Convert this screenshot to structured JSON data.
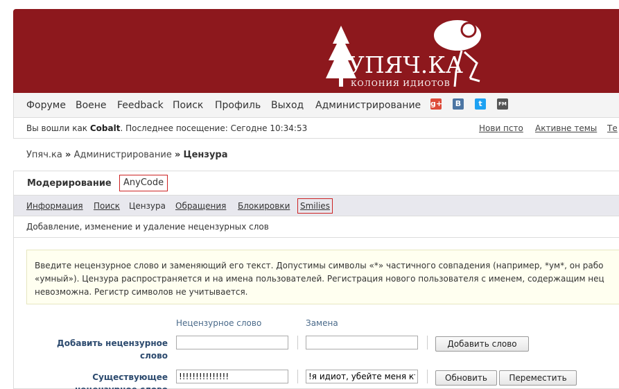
{
  "header": {
    "logo_text": "УПЯЧ.КА",
    "logo_subtitle": "КОЛОНИЯ ИДИОТОВ"
  },
  "nav": {
    "items": [
      "Форуме",
      "Воене",
      "Feedback",
      "Поиск",
      "Профиль",
      "Выход",
      "Администрирование"
    ],
    "social": [
      {
        "name": "google-plus-icon",
        "glyph": "g+",
        "color": "#dd4b39"
      },
      {
        "name": "vk-icon",
        "glyph": "B",
        "color": "#4c75a3"
      },
      {
        "name": "twitter-icon",
        "glyph": "t",
        "color": "#1da1f2"
      },
      {
        "name": "fm-icon",
        "glyph": "FM",
        "color": "#555555"
      }
    ]
  },
  "userbar": {
    "welcome_prefix": "Вы вошли как ",
    "username": "Cobalt",
    "last_visit": ". Последнее посещение: Сегодне 10:34:53",
    "links": [
      "Нови псто",
      "Активне темы",
      "Те"
    ]
  },
  "breadcrumb": {
    "root": "Упяч.ка",
    "sep": "»",
    "section": "Администрирование",
    "current": "Цензура"
  },
  "admin": {
    "title": "Модерирование",
    "anycode": "AnyCode",
    "subtabs": [
      "Информация",
      "Поиск",
      "Цензура",
      "Обращения",
      "Блокировки"
    ],
    "smilies": "Smilies",
    "description": "Добавление, изменение и удаление нецензурных слов",
    "notice_lines": [
      "Введите нецензурное слово и заменяющий его текст. Допустимы символы «*» частичного совпадения (например, *ум*, он рабо",
      "«умный»). Цензура распространяется и на имена пользователей. Регистрация нового пользователя с именем, содержащим нец",
      "невозможна. Регистр символов не учитывается."
    ],
    "col_word": "Нецензурное слово",
    "col_replace": "Замена",
    "add_label": "Добавить нецензурное слово",
    "add_word_value": "",
    "add_replace_value": "",
    "add_button": "Добавить слово",
    "existing_label": "Существующее нецензурное слово",
    "existing_word_value": "!!!!!!!!!!!!!!!",
    "existing_replace_value": "!я идиот, убейте меня ктонибудь",
    "update_button": "Обновить",
    "move_button": "Переместить"
  }
}
